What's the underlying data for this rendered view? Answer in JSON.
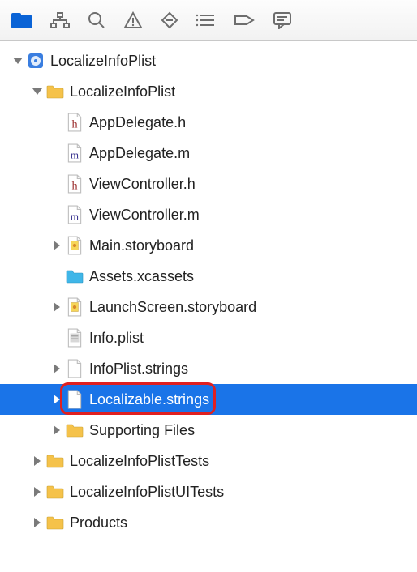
{
  "toolbar": {
    "icons": [
      "folder",
      "hierarchy",
      "search",
      "warning",
      "diamond",
      "list",
      "tag",
      "comment"
    ],
    "active_index": 0
  },
  "tree": [
    {
      "depth": 0,
      "label": "LocalizeInfoPlist",
      "icon": "project",
      "disclosure": "down",
      "interactable": true
    },
    {
      "depth": 1,
      "label": "LocalizeInfoPlist",
      "icon": "folder",
      "disclosure": "down",
      "interactable": true
    },
    {
      "depth": 2,
      "label": "AppDelegate.h",
      "icon": "file-h",
      "disclosure": "none",
      "interactable": true
    },
    {
      "depth": 2,
      "label": "AppDelegate.m",
      "icon": "file-m",
      "disclosure": "none",
      "interactable": true
    },
    {
      "depth": 2,
      "label": "ViewController.h",
      "icon": "file-h",
      "disclosure": "none",
      "interactable": true
    },
    {
      "depth": 2,
      "label": "ViewController.m",
      "icon": "file-m",
      "disclosure": "none",
      "interactable": true
    },
    {
      "depth": 2,
      "label": "Main.storyboard",
      "icon": "storyboard",
      "disclosure": "right",
      "interactable": true
    },
    {
      "depth": 2,
      "label": "Assets.xcassets",
      "icon": "assets",
      "disclosure": "none",
      "interactable": true
    },
    {
      "depth": 2,
      "label": "LaunchScreen.storyboard",
      "icon": "storyboard",
      "disclosure": "right",
      "interactable": true
    },
    {
      "depth": 2,
      "label": "Info.plist",
      "icon": "plist",
      "disclosure": "none",
      "interactable": true
    },
    {
      "depth": 2,
      "label": "InfoPlist.strings",
      "icon": "file-generic",
      "disclosure": "right",
      "interactable": true
    },
    {
      "depth": 2,
      "label": "Localizable.strings",
      "icon": "file-generic",
      "disclosure": "right",
      "interactable": true,
      "selected": true,
      "highlight": true
    },
    {
      "depth": 2,
      "label": "Supporting Files",
      "icon": "folder",
      "disclosure": "right",
      "interactable": true
    },
    {
      "depth": 1,
      "label": "LocalizeInfoPlistTests",
      "icon": "folder",
      "disclosure": "right",
      "interactable": true
    },
    {
      "depth": 1,
      "label": "LocalizeInfoPlistUITests",
      "icon": "folder",
      "disclosure": "right",
      "interactable": true
    },
    {
      "depth": 1,
      "label": "Products",
      "icon": "folder",
      "disclosure": "right",
      "interactable": true
    }
  ],
  "colors": {
    "selection": "#1a74e8",
    "highlight_ring": "#e02020",
    "folder": "#f5c24a",
    "assets": "#3fb6e8",
    "project": "#3a7ee0"
  }
}
